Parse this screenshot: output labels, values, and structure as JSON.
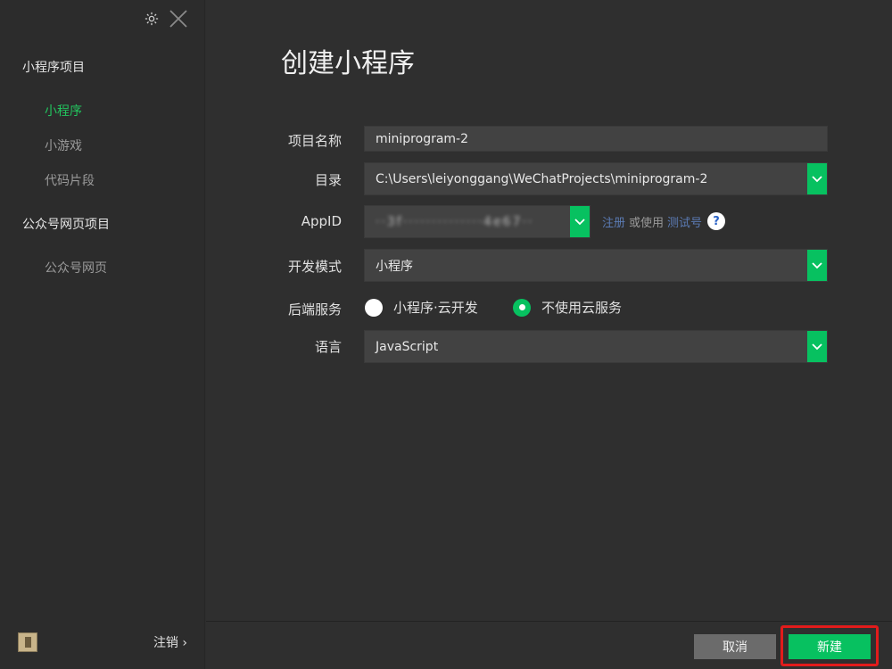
{
  "sidebar": {
    "groups": [
      {
        "label": "小程序项目",
        "items": [
          {
            "label": "小程序",
            "active": true
          },
          {
            "label": "小游戏",
            "active": false
          },
          {
            "label": "代码片段",
            "active": false
          }
        ]
      },
      {
        "label": "公众号网页项目",
        "items": [
          {
            "label": "公众号网页",
            "active": false
          }
        ]
      }
    ],
    "logout_label": "注销 ›"
  },
  "main": {
    "title": "创建小程序",
    "form": {
      "name": {
        "label": "项目名称",
        "value": "miniprogram-2"
      },
      "dir": {
        "label": "目录",
        "value": "C:\\Users\\leiyonggang\\WeChatProjects\\miniprogram-2"
      },
      "appid": {
        "label": "AppID",
        "value": "··3f··············4e67··",
        "register_link": "注册",
        "or_use": "或使用",
        "test_link": "测试号",
        "help_icon": "?"
      },
      "mode": {
        "label": "开发模式",
        "value": "小程序"
      },
      "backend": {
        "label": "后端服务",
        "options": [
          {
            "label": "小程序·云开发",
            "checked": false
          },
          {
            "label": "不使用云服务",
            "checked": true
          }
        ]
      },
      "lang": {
        "label": "语言",
        "value": "JavaScript"
      }
    }
  },
  "footer": {
    "cancel_label": "取消",
    "create_label": "新建"
  },
  "colors": {
    "accent": "#07c160",
    "highlight": "#e21b1b"
  }
}
